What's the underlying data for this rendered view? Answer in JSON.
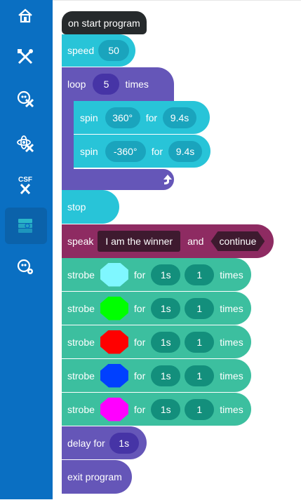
{
  "sidebar": {
    "items": [
      {
        "name": "home-icon"
      },
      {
        "name": "tools-icon"
      },
      {
        "name": "robot-tools-icon"
      },
      {
        "name": "atom-tools-icon"
      },
      {
        "name": "csf-tools-icon",
        "text": "CSF"
      },
      {
        "name": "blocks-icon"
      },
      {
        "name": "robot-settings-icon"
      }
    ]
  },
  "program": {
    "start": "on start program",
    "speed": {
      "label": "speed",
      "value": "50"
    },
    "loop": {
      "label": "loop",
      "count": "5",
      "suffix": "times"
    },
    "spin1": {
      "label": "spin",
      "angle": "360°",
      "for": "for",
      "time": "9.4s"
    },
    "spin2": {
      "label": "spin",
      "angle": "-360°",
      "for": "for",
      "time": "9.4s"
    },
    "stop": "stop",
    "speak": {
      "label": "speak",
      "text": "I am the winner",
      "and": "and",
      "mode": "continue"
    },
    "strobes": [
      {
        "label": "strobe",
        "color": "#7ff7ff",
        "for": "for",
        "duration": "1s",
        "count": "1",
        "suffix": "times"
      },
      {
        "label": "strobe",
        "color": "#00ff00",
        "for": "for",
        "duration": "1s",
        "count": "1",
        "suffix": "times"
      },
      {
        "label": "strobe",
        "color": "#ff0000",
        "for": "for",
        "duration": "1s",
        "count": "1",
        "suffix": "times"
      },
      {
        "label": "strobe",
        "color": "#0040ff",
        "for": "for",
        "duration": "1s",
        "count": "1",
        "suffix": "times"
      },
      {
        "label": "strobe",
        "color": "#ff00ff",
        "for": "for",
        "duration": "1s",
        "count": "1",
        "suffix": "times"
      }
    ],
    "delay": {
      "label": "delay for",
      "value": "1s"
    },
    "exit": "exit program"
  },
  "colors": {
    "sidebar": "#0a6fc2",
    "teal": "#28c4d8",
    "green": "#3cbf9f",
    "purple": "#6556b8",
    "maroon": "#8e2b62",
    "start": "#262a2c"
  }
}
